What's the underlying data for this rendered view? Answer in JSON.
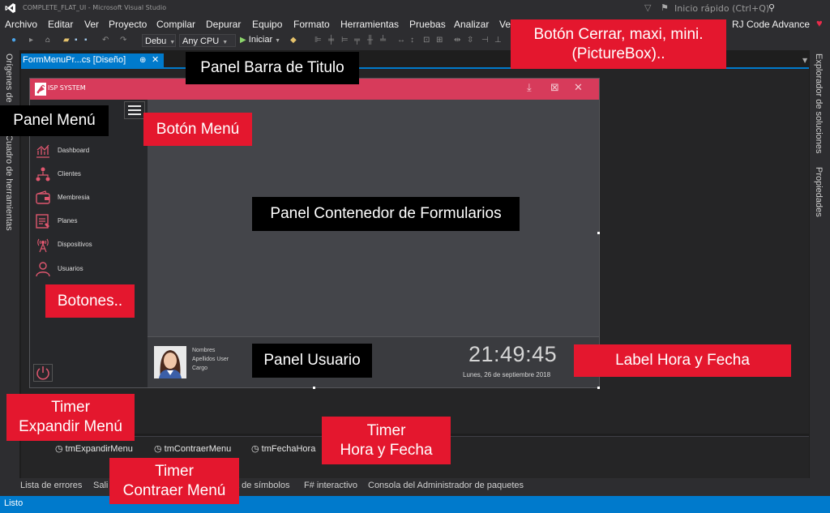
{
  "window": {
    "title": "COMPLETE_FLAT_UI - Microsoft Visual Studio",
    "quick_launch_placeholder": "Inicio rápido (Ctrl+Q)",
    "user": "RJ Code Advance"
  },
  "menu": [
    "Archivo",
    "Editar",
    "Ver",
    "Proyecto",
    "Compilar",
    "Depurar",
    "Equipo",
    "Formato",
    "Herramientas",
    "Pruebas",
    "Analizar",
    "Ve"
  ],
  "toolbar": {
    "config_value": "Debu",
    "platform_value": "Any CPU",
    "start_label": "Iniciar"
  },
  "document_tab": {
    "label": "FormMenuPr...cs [Diseño]"
  },
  "side_panels": {
    "left": [
      "Orígenes de",
      "Cuadro de herramientas"
    ],
    "right": [
      "Explorador de soluciones",
      "Propiedades"
    ]
  },
  "form": {
    "title": "ISP SYSTEM",
    "nav": [
      {
        "label": "Dashboard",
        "icon": "chart-icon"
      },
      {
        "label": "Clientes",
        "icon": "network-icon"
      },
      {
        "label": "Membresia",
        "icon": "wallet-icon"
      },
      {
        "label": "Planes",
        "icon": "plan-icon"
      },
      {
        "label": "Dispositivos",
        "icon": "antenna-icon"
      },
      {
        "label": "Usuarios",
        "icon": "user-icon"
      }
    ],
    "user": {
      "name": "Nombres",
      "lastname": "Apellidos User",
      "role": "Cargo"
    },
    "clock": "21:49:45",
    "date": "Lunes, 26 de septiembre 2018"
  },
  "tray": [
    "tmExpandirMenu",
    "tmContraerMenu",
    "tmFechaHora"
  ],
  "bottom_tabs": [
    "Lista de errores",
    "Sali",
    "a de símbolos",
    "F# interactivo",
    "Consola del Administrador de paquetes"
  ],
  "status": "Listo",
  "callouts": {
    "title_bar": "Panel Barra de Titulo",
    "window_buttons": "Botón Cerrar, maxi, mini.\n(PictureBox)..",
    "menu_panel": "Panel Menú",
    "menu_button": "Botón Menú",
    "content_panel": "Panel Contenedor de Formularios",
    "buttons": "Botones..",
    "user_panel": "Panel Usuario",
    "clock_label": "Label Hora y Fecha",
    "timer_expand": "Timer\nExpandir Menú",
    "timer_clock": "Timer\nHora y Fecha",
    "timer_collapse": "Timer\nContraer Menú"
  },
  "colors": {
    "vs_blue": "#007acc",
    "form_title": "#d73b5b",
    "callout_red": "#e4172e"
  }
}
